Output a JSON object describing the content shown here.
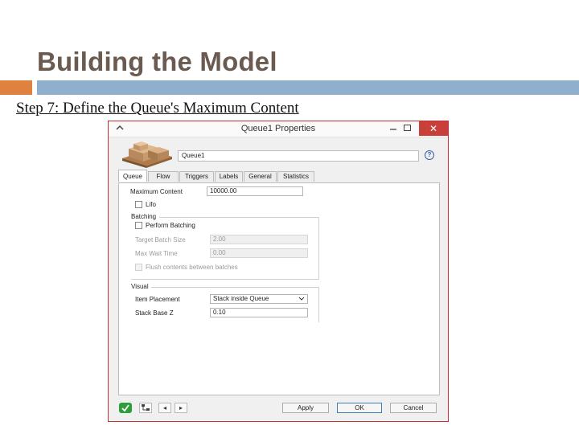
{
  "slide": {
    "title": "Building the Model",
    "step_heading": "Step 7: Define the Queue's Maximum Content"
  },
  "window": {
    "title": "Queue1 Properties",
    "object_name": "Queue1",
    "icons": {
      "up": "chevron-up-icon",
      "minimize": "minimize-icon",
      "maximize": "maximize-icon",
      "close": "close-icon",
      "help": "help-icon",
      "object": "pallet-boxes-icon"
    },
    "tabs": [
      {
        "label": "Queue",
        "active": true
      },
      {
        "label": "Flow",
        "active": false
      },
      {
        "label": "Triggers",
        "active": false
      },
      {
        "label": "Labels",
        "active": false
      },
      {
        "label": "General",
        "active": false
      },
      {
        "label": "Statistics",
        "active": false
      }
    ],
    "queue_tab": {
      "max_content_label": "Maximum Content",
      "max_content_value": "10000.00",
      "lifo_label": "Lifo",
      "lifo_checked": false,
      "batching_group": "Batching",
      "perform_batching_label": "Perform Batching",
      "perform_batching_checked": false,
      "target_batch_size_label": "Target Batch Size",
      "target_batch_size_value": "2.00",
      "max_wait_time_label": "Max Wait Time",
      "max_wait_time_value": "0.00",
      "flush_label": "Flush contents between batches",
      "flush_checked": false,
      "visual_group": "Visual",
      "item_placement_label": "Item Placement",
      "item_placement_value": "Stack inside Queue",
      "stack_base_z_label": "Stack Base Z",
      "stack_base_z_value": "0.10"
    },
    "buttons": {
      "apply": "Apply",
      "ok": "OK",
      "cancel": "Cancel",
      "prev_icon": "arrow-left-icon",
      "next_icon": "arrow-right-icon",
      "status_icon": "green-check-icon",
      "tree_icon": "tree-view-icon"
    },
    "colors": {
      "close_button": "#c9403b",
      "window_border": "#c23232",
      "ok_border": "#3c7fb1"
    }
  },
  "colors": {
    "title_text": "#6b5a4f",
    "accent_orange": "#e0823f",
    "accent_blue": "#8eb0cc"
  }
}
